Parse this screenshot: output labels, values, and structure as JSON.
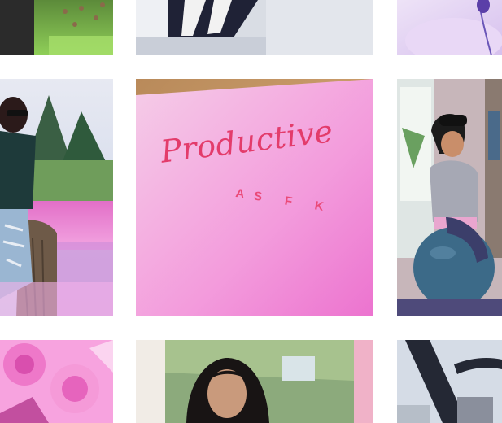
{
  "grid": {
    "card": {
      "caption_main": "Productive",
      "caption_sub": "AS F  K"
    }
  },
  "colors": {
    "background": "#ffffff",
    "accent_pink": "#f07bbd",
    "caption_red": "#e33c6b"
  }
}
